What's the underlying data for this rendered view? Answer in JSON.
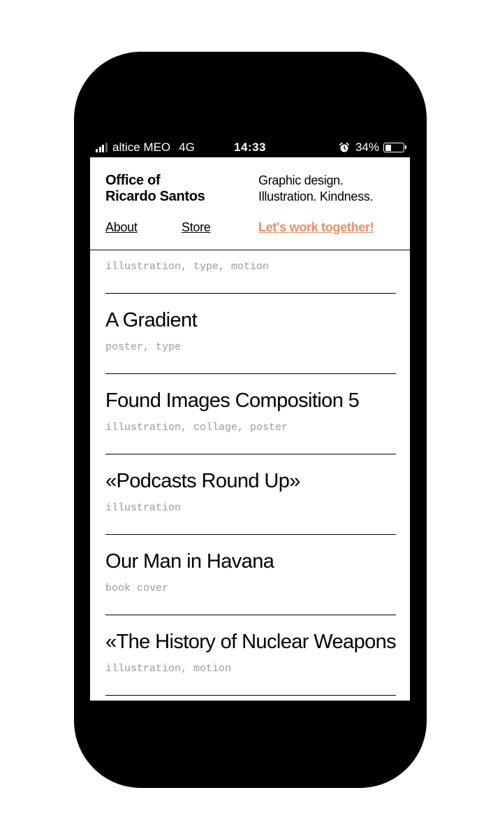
{
  "status_bar": {
    "carrier": "altice MEO",
    "network": "4G",
    "time": "14:33",
    "battery_percent": "34%",
    "battery_level": 0.34,
    "signal_bars_active": 3,
    "icons": [
      "signal-icon",
      "alarm-icon",
      "battery-icon"
    ]
  },
  "header": {
    "brand_line1": "Office of",
    "brand_line2": "Ricardo Santos",
    "tagline_line1": "Graphic design.",
    "tagline_line2": "Illustration. Kindness.",
    "nav": {
      "about": "About",
      "store": "Store",
      "cta": "Let's work together!"
    },
    "cta_color": "#f58a5e"
  },
  "projects": [
    {
      "title": "",
      "tags": "illustration, type, motion"
    },
    {
      "title": "A Gradient",
      "tags": "poster, type"
    },
    {
      "title": "Found Images Composition 5",
      "tags": "illustration, collage, poster"
    },
    {
      "title": "«Podcasts Round Up»",
      "tags": "illustration"
    },
    {
      "title": "Our Man in Havana",
      "tags": "book cover"
    },
    {
      "title": "«The History of Nuclear Weapons»",
      "tags": "illustration, motion"
    }
  ],
  "colors": {
    "frame": "#000000",
    "background": "#ffffff",
    "text": "#000000",
    "tags": "#9a9a9a",
    "accent": "#f58a5e"
  }
}
